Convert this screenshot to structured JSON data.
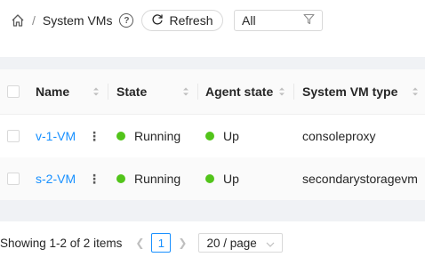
{
  "header": {
    "page_title": "System VMs",
    "refresh_label": "Refresh",
    "filter_value": "All"
  },
  "table": {
    "columns": [
      "Name",
      "State",
      "Agent state",
      "System VM type"
    ],
    "rows": [
      {
        "name": "v-1-VM",
        "state": "Running",
        "agent_state": "Up",
        "type": "consoleproxy"
      },
      {
        "name": "s-2-VM",
        "state": "Running",
        "agent_state": "Up",
        "type": "secondarystoragevm"
      }
    ]
  },
  "pagination": {
    "summary": "Showing 1-2 of 2 items",
    "current_page": "1",
    "page_size": "20 / page"
  },
  "colors": {
    "accent": "#1890ff",
    "status_running": "#52c41a"
  }
}
